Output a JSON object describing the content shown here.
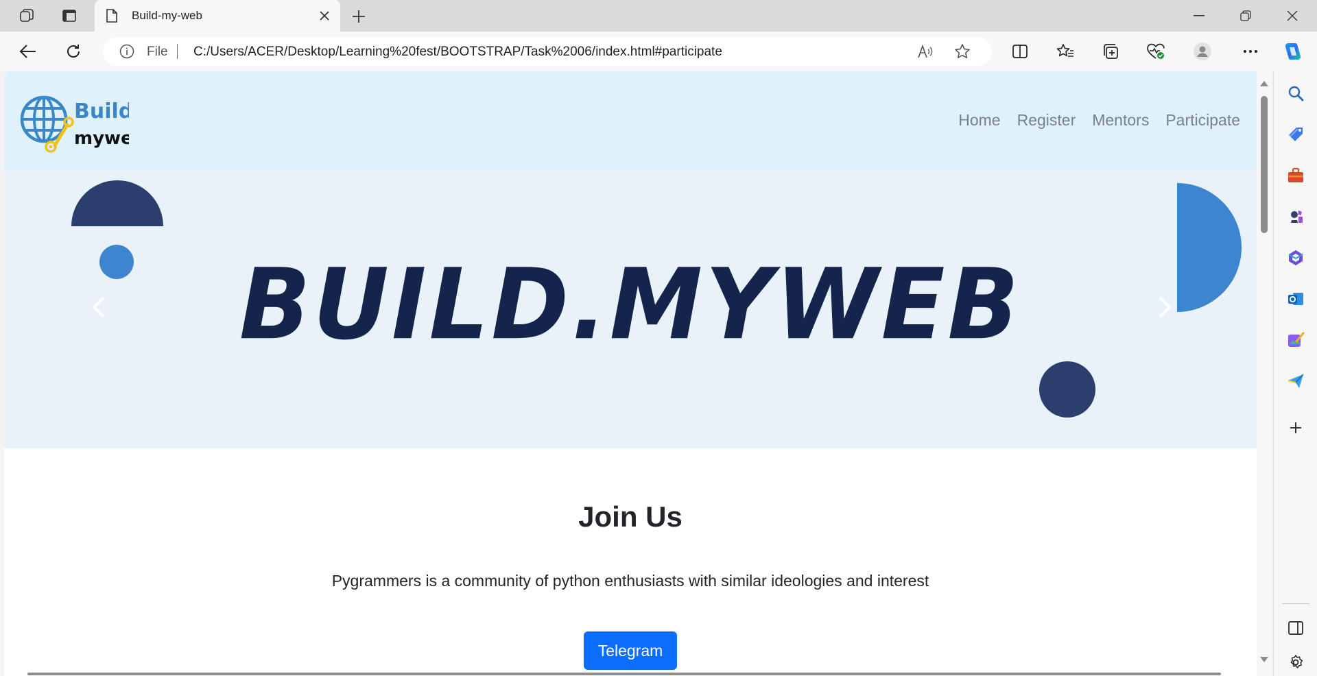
{
  "browser": {
    "tab_title": "Build-my-web",
    "address_prefix": "File",
    "url": "C:/Users/ACER/Desktop/Learning%20fest/BOOTSTRAP/Task%2006/index.html#participate"
  },
  "site": {
    "logo": {
      "line1": "Build.",
      "line2": "myweb"
    },
    "nav": [
      "Home",
      "Register",
      "Mentors",
      "Participate"
    ],
    "hero_title": "BUILD.MYWEB",
    "join": {
      "title": "Join Us",
      "text": "Pygrammers is a community of python enthusiasts with similar ideologies and interest",
      "button": "Telegram"
    }
  },
  "colors": {
    "nav_bg": "#dff2fc",
    "hero_bg": "#e9f1f9",
    "dark_navy": "#15244a",
    "shape_dark": "#2b3f6e",
    "shape_blue": "#3d86cf",
    "button_blue": "#0d6efd"
  },
  "icons": {
    "titlebar": [
      "workspaces-icon",
      "vertical-tabs-icon",
      "page-icon",
      "close-tab-icon",
      "new-tab-icon",
      "minimize-icon",
      "restore-icon",
      "close-window-icon"
    ],
    "toolbar": [
      "back-icon",
      "refresh-icon",
      "info-icon",
      "read-aloud-icon",
      "favorite-star-icon",
      "split-screen-icon",
      "favorites-icon",
      "collections-icon",
      "browser-essentials-icon",
      "profile-icon",
      "more-icon",
      "copilot-icon"
    ],
    "sidebar": [
      "search-icon",
      "shopping-tag-icon",
      "tools-icon",
      "games-icon",
      "microsoft365-icon",
      "outlook-icon",
      "designer-icon",
      "send-icon",
      "add-icon",
      "sidebar-toggle-icon",
      "settings-icon"
    ]
  }
}
